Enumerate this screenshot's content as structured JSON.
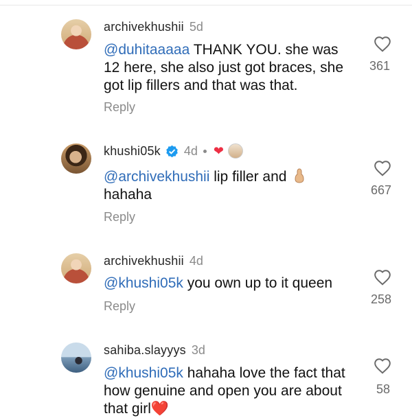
{
  "comments": [
    {
      "username": "archivekhushii",
      "time": "5d",
      "mention": "@duhitaaaaa",
      "text": " THANK YOU. she was 12 here, she also just got braces, she got lip fillers and that was that.",
      "reply_label": "Reply",
      "likes": "361"
    },
    {
      "username": "khushi05k",
      "time": "4d",
      "verified": true,
      "mention": "@archivekhushii",
      "text": " lip filler and ",
      "text_after_emoji": "hahaha",
      "reply_label": "Reply",
      "likes": "667"
    },
    {
      "username": "archivekhushii",
      "time": "4d",
      "mention": "@khushi05k",
      "text": " you own up to it queen",
      "reply_label": "Reply",
      "likes": "258"
    },
    {
      "username": "sahiba.slayyys",
      "time": "3d",
      "mention": "@khushi05k",
      "text": " hahaha love the fact that how genuine and open you are about that girl",
      "text_emoji": "❤️",
      "likes": "58"
    }
  ],
  "icons": {
    "like": "heart-outline-icon",
    "verified": "verified-badge-icon",
    "creator_liked": "red-heart-icon"
  },
  "colors": {
    "mention": "#2f6cb8",
    "verified": "#1d9bf0",
    "heart": "#ed2f44"
  }
}
